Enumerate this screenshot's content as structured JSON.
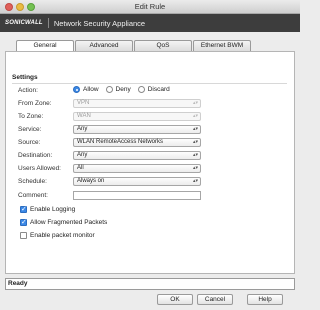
{
  "window": {
    "title": "Edit Rule"
  },
  "brand": {
    "logo": "SONICWALL",
    "title": "Network Security Appliance"
  },
  "tabs": [
    "General",
    "Advanced",
    "QoS",
    "Ethernet BWM"
  ],
  "settings": {
    "heading": "Settings",
    "action": {
      "label": "Action:",
      "options": [
        "Allow",
        "Deny",
        "Discard"
      ],
      "selected": "Allow"
    },
    "from_zone": {
      "label": "From Zone:",
      "value": "VPN"
    },
    "to_zone": {
      "label": "To Zone:",
      "value": "WAN"
    },
    "service": {
      "label": "Service:",
      "value": "Any"
    },
    "source": {
      "label": "Source:",
      "value": "WLAN RemoteAccess Networks"
    },
    "destination": {
      "label": "Destination:",
      "value": "Any"
    },
    "users_allowed": {
      "label": "Users Allowed:",
      "value": "All"
    },
    "schedule": {
      "label": "Schedule:",
      "value": "Always on"
    },
    "comment": {
      "label": "Comment:",
      "value": ""
    },
    "checks": [
      {
        "label": "Enable Logging",
        "checked": true
      },
      {
        "label": "Allow Fragmented Packets",
        "checked": true
      },
      {
        "label": "Enable packet monitor",
        "checked": false
      }
    ]
  },
  "status": {
    "text": "Ready"
  },
  "buttons": {
    "ok": "OK",
    "cancel": "Cancel",
    "help": "Help"
  },
  "icons": {
    "dropdown": "▴▾",
    "check": "✓"
  },
  "colors": {
    "accent": "#3b88e6",
    "brandbar": "#3d3d3d"
  }
}
